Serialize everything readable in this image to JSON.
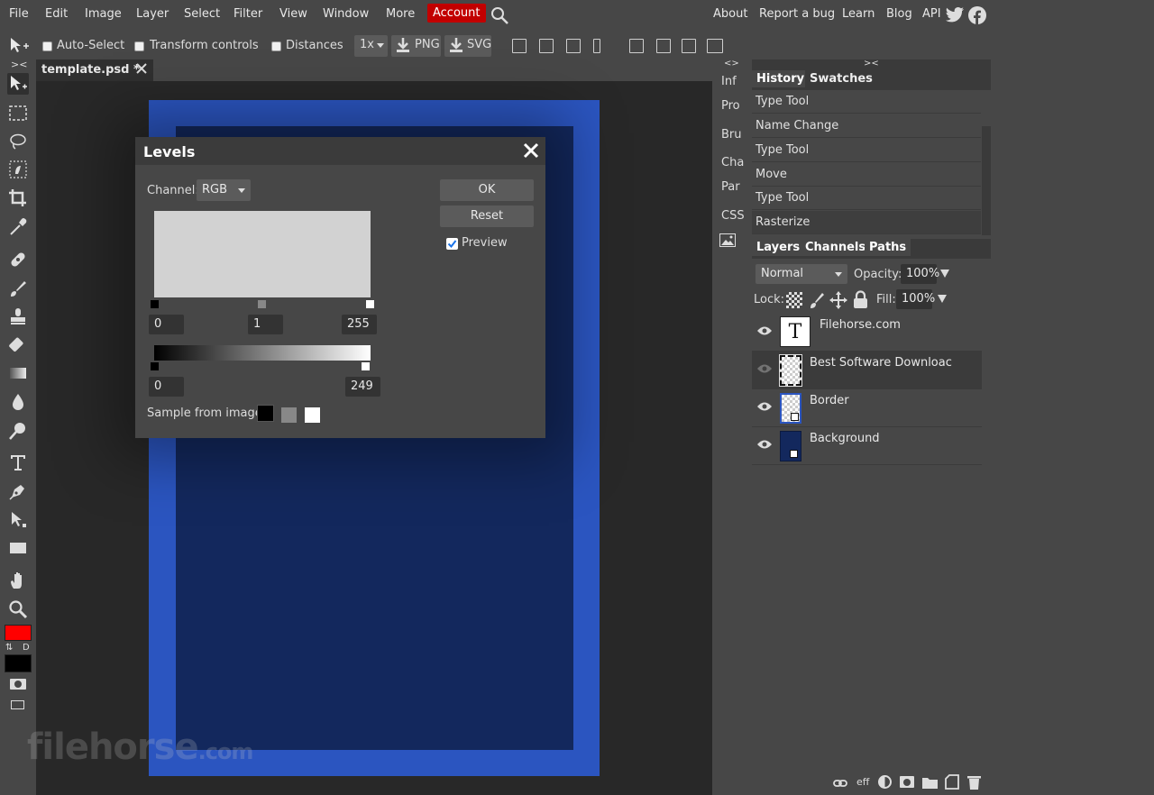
{
  "menubar": {
    "items": [
      "File",
      "Edit",
      "Image",
      "Layer",
      "Select",
      "Filter",
      "View",
      "Window",
      "More"
    ],
    "account": "Account",
    "links": [
      "About",
      "Report a bug",
      "Learn",
      "Blog",
      "API"
    ]
  },
  "options": {
    "auto_select": "Auto-Select",
    "transform_controls": "Transform controls",
    "distances": "Distances",
    "zoom": "1x",
    "png": "PNG",
    "svg": "SVG"
  },
  "document": {
    "tab_title": "template.psd *",
    "canvas_colors": {
      "border": "#2b55c0",
      "background": "#13285d"
    }
  },
  "dock": {
    "collapse_glyph": "<>",
    "items": [
      "Inf",
      "Pro",
      "Bru",
      "Cha",
      "Par",
      "CSS"
    ]
  },
  "history": {
    "collapse_glyph": "><",
    "tabs": [
      "History",
      "Swatches"
    ],
    "items": [
      "Type Tool",
      "Name Change",
      "Type Tool",
      "Move",
      "Type Tool",
      "Rasterize"
    ]
  },
  "layers": {
    "tabs": [
      "Layers",
      "Channels",
      "Paths"
    ],
    "blend_mode": "Normal",
    "opacity_label": "Opacity:",
    "opacity_value": "100%",
    "lock_label": "Lock:",
    "fill_label": "Fill:",
    "fill_value": "100%",
    "items": [
      {
        "name": "Filehorse.com",
        "type": "text",
        "visible": true
      },
      {
        "name": "Best Software Downloac",
        "type": "raster",
        "visible": false
      },
      {
        "name": "Border",
        "type": "raster",
        "visible": true
      },
      {
        "name": "Background",
        "type": "raster",
        "visible": true
      }
    ],
    "footer_eff": "eff"
  },
  "levels": {
    "title": "Levels",
    "channel_label": "Channel:",
    "channel_value": "RGB",
    "ok": "OK",
    "reset": "Reset",
    "preview_label": "Preview",
    "preview_checked": true,
    "input_black": "0",
    "input_gamma": "1",
    "input_white": "255",
    "output_black": "0",
    "output_white": "249",
    "sample_label": "Sample from image:"
  },
  "colors": {
    "foreground": "#ff0000",
    "background": "#000000",
    "account_bg": "#c20000"
  },
  "tools_toggle": "><",
  "swap_default": {
    "swap": "⇅",
    "default": "D"
  },
  "watermark": {
    "main": "filehorse",
    "suffix": ".com"
  }
}
